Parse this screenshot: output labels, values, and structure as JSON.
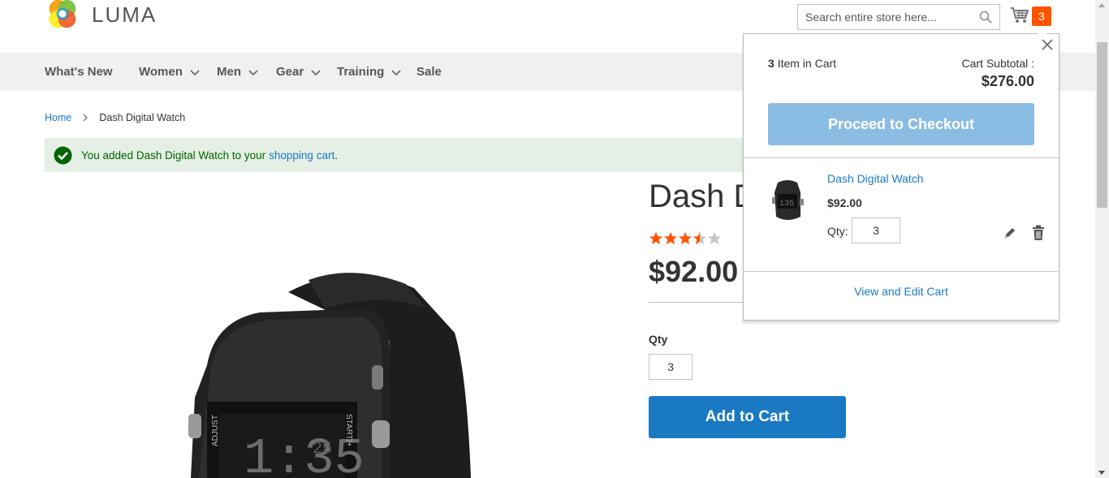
{
  "header": {
    "logo_text": "LUMA",
    "search_placeholder": "Search entire store here...",
    "cart_count": "3"
  },
  "nav": {
    "items": [
      {
        "label": "What's New"
      },
      {
        "label": "Women"
      },
      {
        "label": "Men"
      },
      {
        "label": "Gear"
      },
      {
        "label": "Training"
      },
      {
        "label": "Sale"
      }
    ]
  },
  "breadcrumb": {
    "home": "Home",
    "current": "Dash Digital Watch"
  },
  "message": {
    "text": "You added Dash Digital Watch to your",
    "link": "shopping cart",
    "suffix": "."
  },
  "product": {
    "title": "Dash Digital Watch",
    "rating_stars": 3.5,
    "rating_max": 5,
    "price": "$92.00",
    "qty_label": "Qty",
    "qty_value": "3",
    "add_to_cart_label": "Add to Cart"
  },
  "minicart": {
    "count": "3",
    "count_label": "Item in Cart",
    "subtotal_label": "Cart Subtotal :",
    "subtotal_value": "$276.00",
    "checkout_label": "Proceed to Checkout",
    "item": {
      "name": "Dash Digital Watch",
      "price": "$92.00",
      "qty_label": "Qty:",
      "qty_value": "3"
    },
    "view_cart_label": "View and Edit Cart"
  },
  "colors": {
    "accent_blue": "#1979c3",
    "badge_orange": "#ff5501",
    "star_orange": "#ff5501",
    "success_bg": "#e5efe5",
    "checkout_disabled": "#8bbce3"
  },
  "icons": {
    "search": "search-icon",
    "cart": "cart-icon",
    "close": "close-icon",
    "edit": "pencil-icon",
    "delete": "trash-icon",
    "success": "check-circle-icon",
    "chevron": "chevron-down-icon"
  }
}
